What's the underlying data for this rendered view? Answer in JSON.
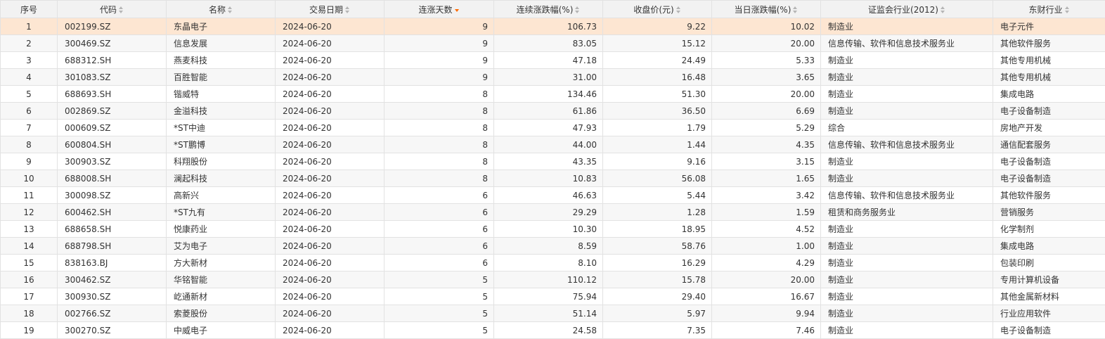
{
  "colors": {
    "sort_active": "#ff6a00",
    "highlight_row": "#fde6d2",
    "header_bg": "#f2f2f2"
  },
  "headers": [
    {
      "label": "序号",
      "sortable": false
    },
    {
      "label": "代码",
      "sortable": true
    },
    {
      "label": "名称",
      "sortable": true
    },
    {
      "label": "交易日期",
      "sortable": true
    },
    {
      "label": "连涨天数",
      "sortable": true,
      "active": true
    },
    {
      "label": "连续涨跌幅(%)",
      "sortable": true
    },
    {
      "label": "收盘价(元)",
      "sortable": true
    },
    {
      "label": "当日涨跌幅(%)",
      "sortable": true
    },
    {
      "label": "证监会行业(2012)",
      "sortable": true
    },
    {
      "label": "东财行业",
      "sortable": true
    }
  ],
  "rows": [
    [
      "1",
      "002199.SZ",
      "东晶电子",
      "2024-06-20",
      "9",
      "106.73",
      "9.22",
      "10.02",
      "制造业",
      "电子元件"
    ],
    [
      "2",
      "300469.SZ",
      "信息发展",
      "2024-06-20",
      "9",
      "83.05",
      "15.12",
      "20.00",
      "信息传输、软件和信息技术服务业",
      "其他软件服务"
    ],
    [
      "3",
      "688312.SH",
      "燕麦科技",
      "2024-06-20",
      "9",
      "47.18",
      "24.49",
      "5.33",
      "制造业",
      "其他专用机械"
    ],
    [
      "4",
      "301083.SZ",
      "百胜智能",
      "2024-06-20",
      "9",
      "31.00",
      "16.48",
      "3.65",
      "制造业",
      "其他专用机械"
    ],
    [
      "5",
      "688693.SH",
      "锴威特",
      "2024-06-20",
      "8",
      "134.46",
      "51.30",
      "20.00",
      "制造业",
      "集成电路"
    ],
    [
      "6",
      "002869.SZ",
      "金溢科技",
      "2024-06-20",
      "8",
      "61.86",
      "36.50",
      "6.69",
      "制造业",
      "电子设备制造"
    ],
    [
      "7",
      "000609.SZ",
      "*ST中迪",
      "2024-06-20",
      "8",
      "47.93",
      "1.79",
      "5.29",
      "综合",
      "房地产开发"
    ],
    [
      "8",
      "600804.SH",
      "*ST鹏博",
      "2024-06-20",
      "8",
      "44.00",
      "1.44",
      "4.35",
      "信息传输、软件和信息技术服务业",
      "通信配套服务"
    ],
    [
      "9",
      "300903.SZ",
      "科翔股份",
      "2024-06-20",
      "8",
      "43.35",
      "9.16",
      "3.15",
      "制造业",
      "电子设备制造"
    ],
    [
      "10",
      "688008.SH",
      "澜起科技",
      "2024-06-20",
      "8",
      "10.83",
      "56.08",
      "1.65",
      "制造业",
      "电子设备制造"
    ],
    [
      "11",
      "300098.SZ",
      "高新兴",
      "2024-06-20",
      "6",
      "46.63",
      "5.44",
      "3.42",
      "信息传输、软件和信息技术服务业",
      "其他软件服务"
    ],
    [
      "12",
      "600462.SH",
      "*ST九有",
      "2024-06-20",
      "6",
      "29.29",
      "1.28",
      "1.59",
      "租赁和商务服务业",
      "营销服务"
    ],
    [
      "13",
      "688658.SH",
      "悦康药业",
      "2024-06-20",
      "6",
      "10.30",
      "18.95",
      "4.52",
      "制造业",
      "化学制剂"
    ],
    [
      "14",
      "688798.SH",
      "艾为电子",
      "2024-06-20",
      "6",
      "8.59",
      "58.76",
      "1.00",
      "制造业",
      "集成电路"
    ],
    [
      "15",
      "838163.BJ",
      "方大新材",
      "2024-06-20",
      "6",
      "8.10",
      "16.29",
      "4.29",
      "制造业",
      "包装印刷"
    ],
    [
      "16",
      "300462.SZ",
      "华铭智能",
      "2024-06-20",
      "5",
      "110.12",
      "15.78",
      "20.00",
      "制造业",
      "专用计算机设备"
    ],
    [
      "17",
      "300930.SZ",
      "屹通新材",
      "2024-06-20",
      "5",
      "75.94",
      "29.40",
      "16.67",
      "制造业",
      "其他金属新材料"
    ],
    [
      "18",
      "002766.SZ",
      "索菱股份",
      "2024-06-20",
      "5",
      "51.14",
      "5.97",
      "9.94",
      "制造业",
      "行业应用软件"
    ],
    [
      "19",
      "300270.SZ",
      "中威电子",
      "2024-06-20",
      "5",
      "24.58",
      "7.35",
      "7.46",
      "制造业",
      "电子设备制造"
    ]
  ]
}
